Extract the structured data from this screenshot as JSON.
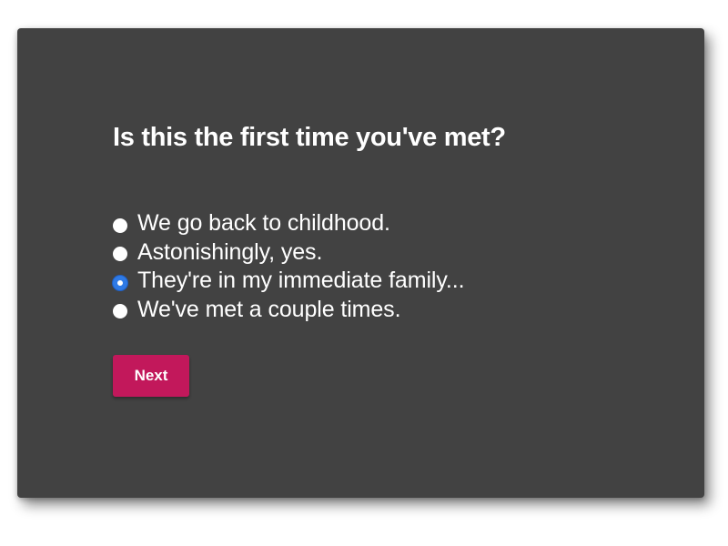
{
  "form": {
    "question": "Is this the first time you've met?",
    "options": [
      {
        "label": "We go back to childhood.",
        "selected": false
      },
      {
        "label": "Astonishingly, yes.",
        "selected": false
      },
      {
        "label": "They're in my immediate family...",
        "selected": true
      },
      {
        "label": "We've met a couple times.",
        "selected": false
      }
    ],
    "next_label": "Next"
  },
  "colors": {
    "card_background": "#424242",
    "page_background": "#ffffff",
    "button_background": "#c2185b",
    "radio_selected": "#2f7ae5",
    "text": "#ffffff"
  }
}
